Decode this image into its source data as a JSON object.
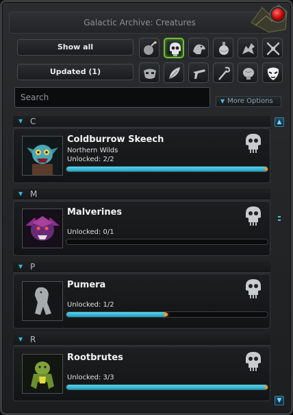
{
  "window": {
    "title": "Galactic Archive: Creatures"
  },
  "filters": {
    "show_all_label": "Show all",
    "updated_label": "Updated (1)",
    "row1_icons": [
      "bomb-icon",
      "skull-icon",
      "creature-head-icon",
      "potion-icon",
      "dragon-icon",
      "swirl-icon"
    ],
    "row2_icons": [
      "mask-icon",
      "feather-icon",
      "gun-icon",
      "staff-icon",
      "brain-icon",
      "face-mask-icon"
    ],
    "selected_icon": "skull-icon"
  },
  "search": {
    "placeholder": "Search"
  },
  "more_options_label": "More Options",
  "sections": [
    {
      "letter": "C",
      "creature": {
        "name": "Coldburrow Skeech",
        "region": "Northern Wilds",
        "unlocked_text": "Unlocked: 2/2",
        "progress": 1.0,
        "portrait_icon": "blue-goblin-portrait"
      }
    },
    {
      "letter": "M",
      "creature": {
        "name": "Malverines",
        "region": "",
        "unlocked_text": "Unlocked: 0/1",
        "progress": 0.0,
        "portrait_icon": "purple-beast-portrait"
      }
    },
    {
      "letter": "P",
      "creature": {
        "name": "Pumera",
        "region": "",
        "unlocked_text": "Unlocked: 1/2",
        "progress": 0.5,
        "portrait_icon": "grey-beast-portrait"
      }
    },
    {
      "letter": "R",
      "creature": {
        "name": "Rootbrutes",
        "region": "",
        "unlocked_text": "Unlocked: 3/3",
        "progress": 1.0,
        "portrait_icon": "green-brute-portrait"
      }
    }
  ],
  "colors": {
    "accent": "#35b7dd",
    "selected": "#6fbf37",
    "progress_tip": "#ff9c2a"
  }
}
